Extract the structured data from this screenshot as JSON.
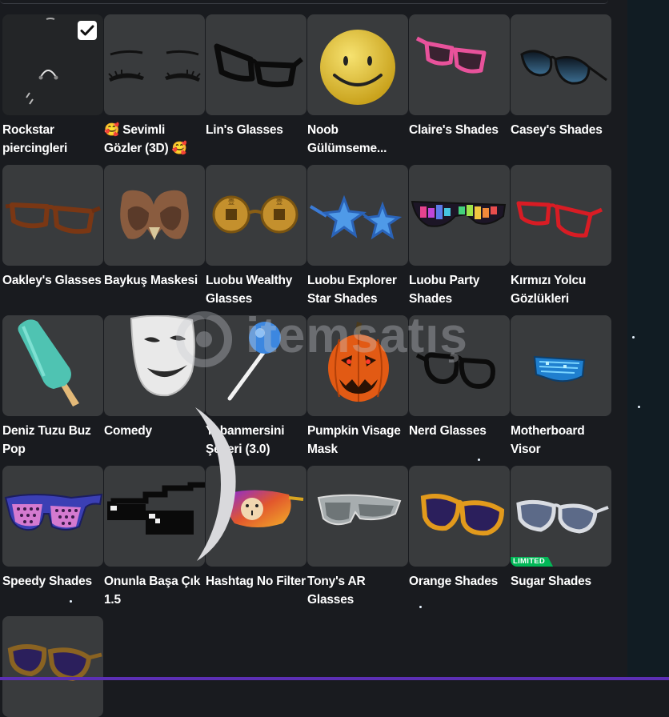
{
  "items": [
    {
      "name": "Rockstar piercingleri",
      "icon": "piercing-icon",
      "selected": true
    },
    {
      "name": "🥰 Sevimli Gözler (3D) 🥰",
      "icon": "cute-eyes-icon"
    },
    {
      "name": "Lin's Glasses",
      "icon": "black-glasses-icon"
    },
    {
      "name": "Noob Gülümseme...",
      "icon": "noob-smile-icon"
    },
    {
      "name": "Claire's Shades",
      "icon": "pink-shades-icon"
    },
    {
      "name": "Casey's Shades",
      "icon": "aviator-shades-icon"
    },
    {
      "name": "Oakley's Glasses",
      "icon": "brown-glasses-icon"
    },
    {
      "name": "Baykuş Maskesi",
      "icon": "owl-mask-icon"
    },
    {
      "name": "Luobu Wealthy Glasses",
      "icon": "coin-glasses-icon"
    },
    {
      "name": "Luobu Explorer Star Shades",
      "icon": "star-shades-icon"
    },
    {
      "name": "Luobu Party Shades",
      "icon": "party-shades-icon"
    },
    {
      "name": "Kırmızı Yolcu Gözlükleri",
      "icon": "red-glasses-icon"
    },
    {
      "name": "Deniz Tuzu Buz Pop",
      "icon": "ice-pop-icon"
    },
    {
      "name": "Comedy",
      "icon": "comedy-mask-icon"
    },
    {
      "name": "Yabanmersini Şekeri (3.0)",
      "icon": "lollipop-icon"
    },
    {
      "name": "Pumpkin Visage Mask",
      "icon": "pumpkin-mask-icon"
    },
    {
      "name": "Nerd Glasses",
      "icon": "nerd-glasses-icon"
    },
    {
      "name": "Motherboard Visor",
      "icon": "visor-icon"
    },
    {
      "name": "Speedy Shades",
      "icon": "speedy-shades-icon"
    },
    {
      "name": "Onunla Başa Çık 1.5",
      "icon": "pixel-shades-icon"
    },
    {
      "name": "Hashtag No Filter",
      "icon": "bear-filter-icon"
    },
    {
      "name": "Tony's AR Glasses",
      "icon": "ar-glasses-icon"
    },
    {
      "name": "Orange Shades",
      "icon": "orange-shades-icon"
    },
    {
      "name": "Sugar Shades",
      "icon": "sugar-shades-icon",
      "badge": "LIMITED"
    },
    {
      "name": "",
      "icon": "purple-shades-icon"
    }
  ],
  "watermark": "itemsatış",
  "colors": {
    "card": "#393b3d",
    "background": "#191b1f",
    "limited": "#02b757",
    "accent_bar": "#5c2fb4"
  }
}
